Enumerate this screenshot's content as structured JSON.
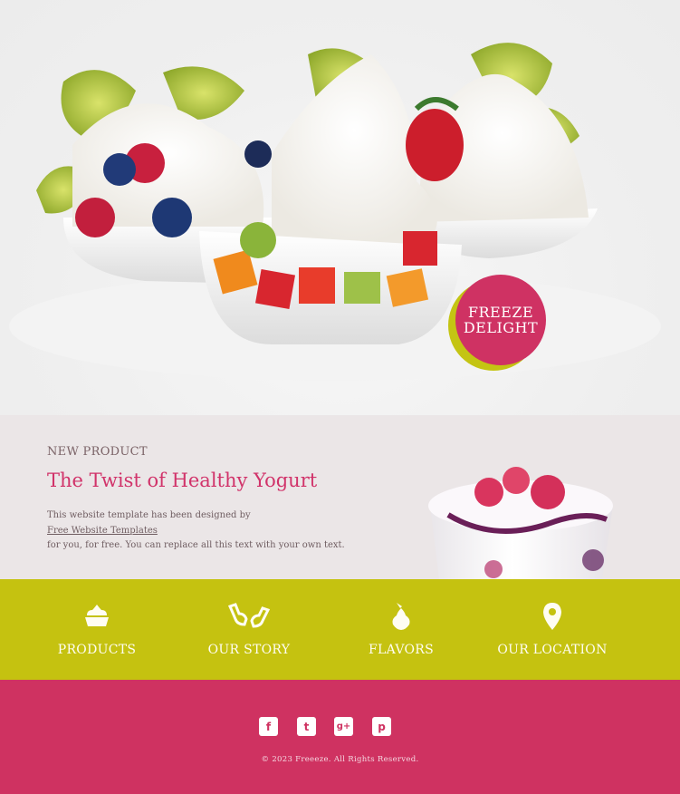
{
  "hero": {
    "badge_line1": "FREEZE",
    "badge_line2": "DELIGHT"
  },
  "product": {
    "kicker": "NEW PRODUCT",
    "title": "The Twist of Healthy Yogurt",
    "desc_line1": "This website template has been designed by",
    "desc_link": "Free Website Templates",
    "desc_line2": "for you, for free. You can replace all this text with your own text."
  },
  "nav": {
    "items": [
      {
        "label": "PRODUCTS",
        "icon": "cupcake-icon"
      },
      {
        "label": "OUR STORY",
        "icon": "hands-icon"
      },
      {
        "label": "FLAVORS",
        "icon": "pear-icon"
      },
      {
        "label": "OUR LOCATION",
        "icon": "map-pin-icon"
      }
    ]
  },
  "footer": {
    "social": [
      {
        "glyph": "f",
        "icon": "facebook-icon"
      },
      {
        "glyph": "t",
        "icon": "twitter-icon"
      },
      {
        "glyph": "g+",
        "icon": "google-plus-icon"
      },
      {
        "glyph": "p",
        "icon": "pinterest-icon"
      }
    ],
    "copyright": "© 2023 Freeeze. All Rights Reserved."
  },
  "colors": {
    "accent_pink": "#cf3261",
    "accent_lime": "#c5c210",
    "product_bg": "#ebe6e7"
  }
}
